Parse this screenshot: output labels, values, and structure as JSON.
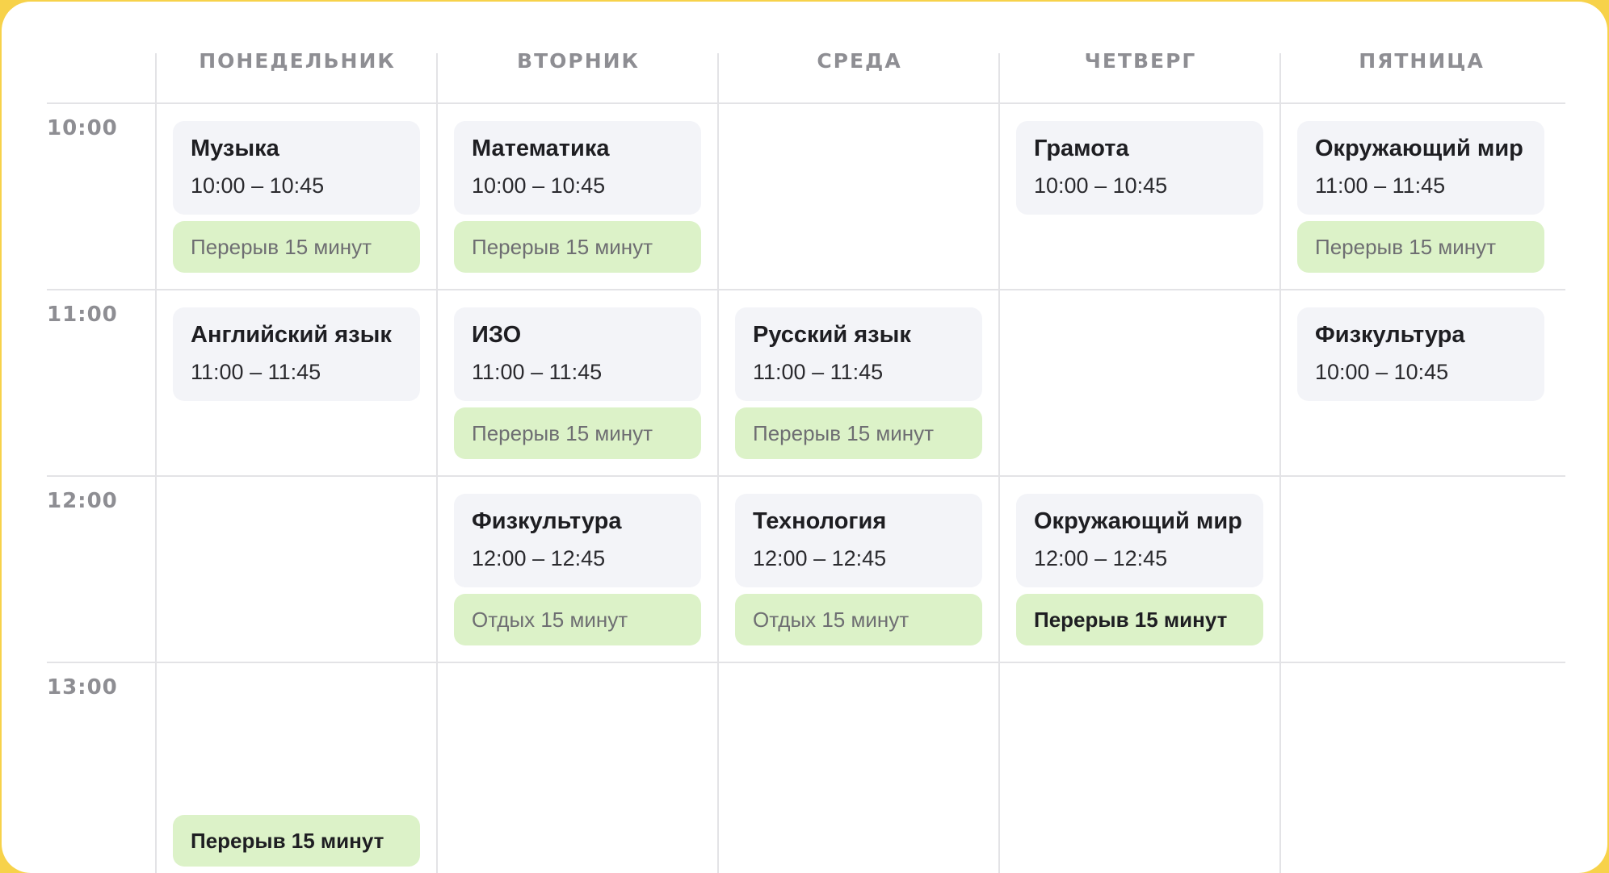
{
  "days": [
    "ПОНЕДЕЛЬНИК",
    "ВТОРНИК",
    "СРЕДА",
    "ЧЕТВЕРГ",
    "ПЯТНИЦА"
  ],
  "times": [
    "10:00",
    "11:00",
    "12:00",
    "13:00"
  ],
  "lessons": [
    {
      "title": "Музыка",
      "time": "10:00 – 10:45"
    },
    {
      "title": "Английский язык",
      "time": "11:00 – 11:45"
    },
    {
      "title": "Математика",
      "time": "10:00 – 10:45"
    },
    {
      "title": "ИЗО",
      "time": "11:00 – 11:45"
    },
    {
      "title": "Физкультура",
      "time": "12:00 – 12:45"
    },
    {
      "title": "Русский язык",
      "time": "11:00 – 11:45"
    },
    {
      "title": "Технология",
      "time": "12:00 – 12:45"
    },
    {
      "title": "Грамота",
      "time": "10:00 – 10:45"
    },
    {
      "title": "Окружающий мир",
      "time": "12:00 – 12:45"
    },
    {
      "title": "Окружающий мир",
      "time": "11:00 – 11:45"
    },
    {
      "title": "Физкультура",
      "time": "10:00 – 10:45"
    }
  ],
  "breaks": [
    "Перерыв 15 минут",
    "Перерыв 15 минут",
    "Перерыв 15 минут",
    "Перерыв 15 минут",
    "Отдых 15 минут",
    "Перерыв 15 минут",
    "Отдых 15 минут",
    "Перерыв 15 минут",
    "Перерыв 15 минут"
  ]
}
